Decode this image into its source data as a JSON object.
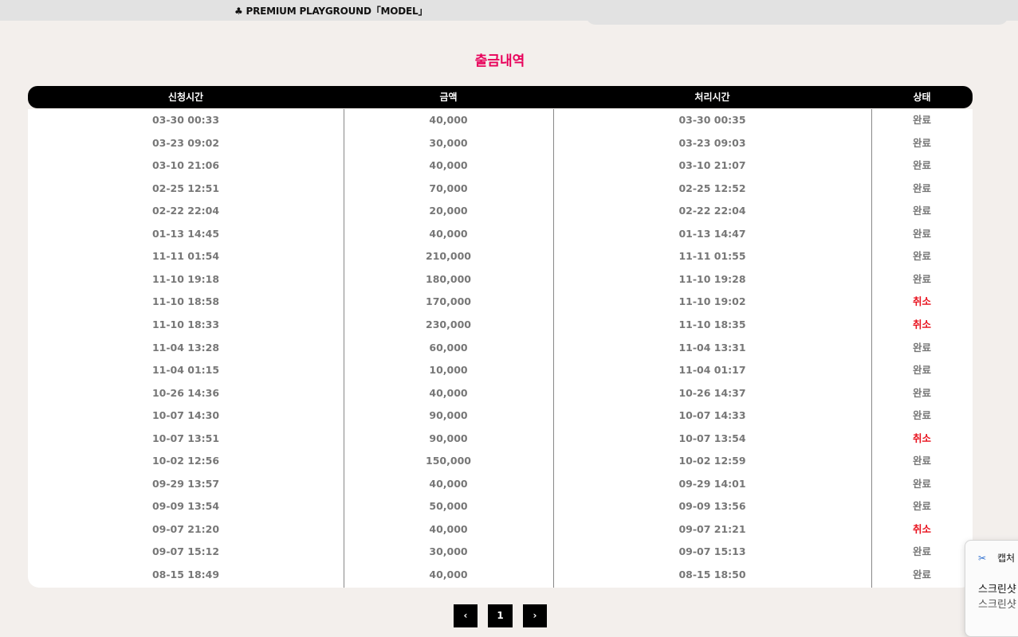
{
  "topbar": {
    "title": "♣ PREMIUM PLAYGROUND「MODEL」"
  },
  "page": {
    "title": "출금내역",
    "title_color": "#e8005a",
    "cancel_color": "#e8101c"
  },
  "table": {
    "headers": [
      "신청시간",
      "금액",
      "처리시간",
      "상태"
    ],
    "rows": [
      {
        "requested": "03-30 00:33",
        "amount": "40,000",
        "processed": "03-30 00:35",
        "status": "완료"
      },
      {
        "requested": "03-23 09:02",
        "amount": "30,000",
        "processed": "03-23 09:03",
        "status": "완료"
      },
      {
        "requested": "03-10 21:06",
        "amount": "40,000",
        "processed": "03-10 21:07",
        "status": "완료"
      },
      {
        "requested": "02-25 12:51",
        "amount": "70,000",
        "processed": "02-25 12:52",
        "status": "완료"
      },
      {
        "requested": "02-22 22:04",
        "amount": "20,000",
        "processed": "02-22 22:04",
        "status": "완료"
      },
      {
        "requested": "01-13 14:45",
        "amount": "40,000",
        "processed": "01-13 14:47",
        "status": "완료"
      },
      {
        "requested": "11-11 01:54",
        "amount": "210,000",
        "processed": "11-11 01:55",
        "status": "완료"
      },
      {
        "requested": "11-10 19:18",
        "amount": "180,000",
        "processed": "11-10 19:28",
        "status": "완료"
      },
      {
        "requested": "11-10 18:58",
        "amount": "170,000",
        "processed": "11-10 19:02",
        "status": "취소"
      },
      {
        "requested": "11-10 18:33",
        "amount": "230,000",
        "processed": "11-10 18:35",
        "status": "취소"
      },
      {
        "requested": "11-04 13:28",
        "amount": "60,000",
        "processed": "11-04 13:31",
        "status": "완료"
      },
      {
        "requested": "11-04 01:15",
        "amount": "10,000",
        "processed": "11-04 01:17",
        "status": "완료"
      },
      {
        "requested": "10-26 14:36",
        "amount": "40,000",
        "processed": "10-26 14:37",
        "status": "완료"
      },
      {
        "requested": "10-07 14:30",
        "amount": "90,000",
        "processed": "10-07 14:33",
        "status": "완료"
      },
      {
        "requested": "10-07 13:51",
        "amount": "90,000",
        "processed": "10-07 13:54",
        "status": "취소"
      },
      {
        "requested": "10-02 12:56",
        "amount": "150,000",
        "processed": "10-02 12:59",
        "status": "완료"
      },
      {
        "requested": "09-29 13:57",
        "amount": "40,000",
        "processed": "09-29 14:01",
        "status": "완료"
      },
      {
        "requested": "09-09 13:54",
        "amount": "50,000",
        "processed": "09-09 13:56",
        "status": "완료"
      },
      {
        "requested": "09-07 21:20",
        "amount": "40,000",
        "processed": "09-07 21:21",
        "status": "취소"
      },
      {
        "requested": "09-07 15:12",
        "amount": "30,000",
        "processed": "09-07 15:13",
        "status": "완료"
      },
      {
        "requested": "08-15 18:49",
        "amount": "40,000",
        "processed": "08-15 18:50",
        "status": "완료"
      }
    ]
  },
  "pagination": {
    "prev_icon": "chevron-left-icon",
    "prev_glyph": "‹",
    "current_page": "1",
    "next_icon": "chevron-right-icon",
    "next_glyph": "›"
  },
  "capture_panel": {
    "icon": "scissors-icon",
    "icon_glyph": "✂",
    "title": "캡처",
    "line1": "스크린샷",
    "line2": "스크린샷"
  }
}
